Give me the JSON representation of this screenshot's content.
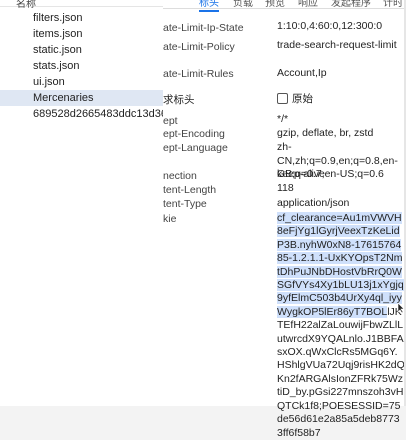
{
  "left": {
    "header": "名称",
    "files": [
      {
        "name": "filters.json"
      },
      {
        "name": "items.json"
      },
      {
        "name": "static.json"
      },
      {
        "name": "stats.json"
      },
      {
        "name": "ui.json"
      },
      {
        "name": "Mercenaries",
        "selected": true
      },
      {
        "name": "689528d2665483ddc13d36..."
      }
    ]
  },
  "right": {
    "tabs": [
      "标头",
      "负载",
      "预览",
      "响应",
      "发起程序",
      "计时"
    ],
    "top_rows": [
      {
        "key": "ate-Limit-Ip-State",
        "val": "1:10:0,4:60:0,12:300:0"
      },
      {
        "key": "ate-Limit-Policy",
        "val": "trade-search-request-limit"
      },
      {
        "key": "ate-Limit-Rules",
        "val": "Account,Ip"
      }
    ],
    "request_section": "求标头",
    "raw_label": "原始",
    "rows": [
      {
        "key": "ept",
        "val": "*/*"
      },
      {
        "key": "ept-Encoding",
        "val": "gzip, deflate, br, zstd"
      },
      {
        "key": "ept-Language",
        "val": "zh-CN,zh;q=0.9,en;q=0.8,en-GB;q=0.7,en-US;q=0.6"
      },
      {
        "key": "nection",
        "val": "keep-alive"
      },
      {
        "key": "tent-Length",
        "val": "118"
      },
      {
        "key": "tent-Type",
        "val": "application/json"
      },
      {
        "key": "kie",
        "val": ""
      }
    ],
    "cookie_selected": "cf_clearance=Au1mVWVH8eFjYg1lGyrjVeexTzKeLidP3B.nyhW0xN8-1761576485-1.2.1.1-UxKYOpsT2NmtDhPuJNbDHostVbRrQ0WSGfVYs4Xy1bLU13j1xYgjq9yfElmC503b4UrXy4ql_iyyWygkOP5lEr86yT7BOL",
    "cookie_rest": "lJKTEfH22alZaLouwijFbwZLlLutwrcdX9YQALnlo.J1BBFAsxOX.qWxClcRs5MGq6Y.HShlgVUa72Uqj9risHK2dQKn2fARGAlsIonZFRk75WztiD_by.pGsi227mnszoh3vHQTCk1f8;POESESSID=75de56d61e2a85a5deb87733ff6f58b7"
  }
}
